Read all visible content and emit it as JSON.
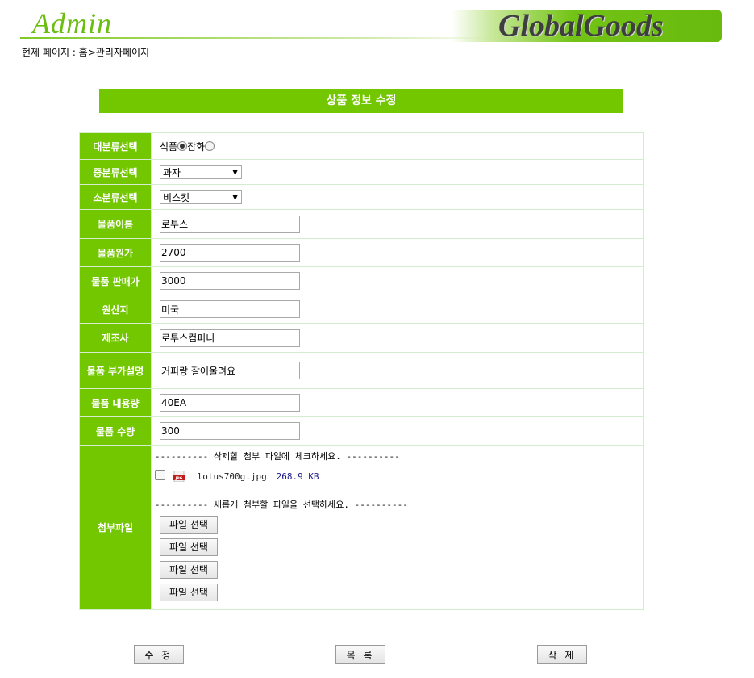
{
  "header": {
    "admin_logo": "Admin",
    "brand": "GlobalGoods",
    "breadcrumb": "현제 페이지 : 홈>관리자페이지"
  },
  "page_title": "상품 정보 수정",
  "form": {
    "category_large": {
      "label": "대분류선택",
      "options": [
        {
          "label": "식품",
          "checked": true
        },
        {
          "label": "잡화",
          "checked": false
        }
      ]
    },
    "category_mid": {
      "label": "중분류선택",
      "selected": "과자"
    },
    "category_small": {
      "label": "소분류선택",
      "selected": "비스킷"
    },
    "product_name": {
      "label": "물품이름",
      "value": "로투스"
    },
    "cost_price": {
      "label": "물품원가",
      "value": "2700"
    },
    "sale_price": {
      "label": "물품 판매가",
      "value": "3000"
    },
    "origin": {
      "label": "원산지",
      "value": "미국"
    },
    "manufacturer": {
      "label": "제조사",
      "value": "로투스컴퍼니"
    },
    "description": {
      "label": "물품 부가설명",
      "value": "커피랑 잘어울려요"
    },
    "volume": {
      "label": "물품 내용량",
      "value": "40EA"
    },
    "quantity": {
      "label": "물품 수량",
      "value": "300"
    },
    "attachments": {
      "label": "첨부파일",
      "delete_note": "---------- 삭제할 첨부 파일에 체크하세요. ----------",
      "existing_file": {
        "name": "lotus700g.jpg",
        "size": "268.9 KB",
        "icon": "jpg-file-icon"
      },
      "new_note": "---------- 새롭게 첨부할 파일을 선택하세요. ----------",
      "file_button_label": "파일 선택"
    }
  },
  "buttons": {
    "edit": "수 정",
    "list": "목 록",
    "delete": "삭 제"
  },
  "colors": {
    "accent": "#73c700",
    "header_green": "#6cbd12"
  }
}
